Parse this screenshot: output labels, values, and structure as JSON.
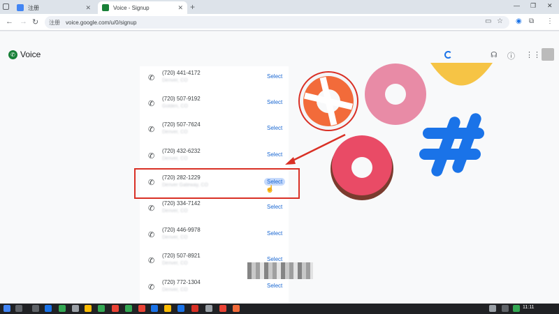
{
  "browser": {
    "tabs": [
      {
        "label": "注册",
        "favicon_color": "#4285f4"
      },
      {
        "label": "Voice - Signup",
        "favicon_color": "#188038"
      }
    ],
    "url": "voice.google.com/u/0/signup",
    "url_chip": "注册"
  },
  "app": {
    "name": "Voice",
    "accent": "#1a73e8"
  },
  "numbers": [
    {
      "number": "(720) 441-4172",
      "location": "Denver, CO",
      "action": "Select"
    },
    {
      "number": "(720) 507-9192",
      "location": "Golden, CO",
      "action": "Select"
    },
    {
      "number": "(720) 507-7624",
      "location": "Denver, CO",
      "action": "Select"
    },
    {
      "number": "(720) 432-6232",
      "location": "Denver, CO",
      "action": "Select"
    },
    {
      "number": "(720) 282-1229",
      "location": "Denver Gateway, CO",
      "action": "Select",
      "highlighted": true
    },
    {
      "number": "(720) 334-7142",
      "location": "Denver, CO",
      "action": "Select"
    },
    {
      "number": "(720) 446-9978",
      "location": "Denver, CO",
      "action": "Select"
    },
    {
      "number": "(720) 507-8921",
      "location": "Denver, CO",
      "action": "Select"
    },
    {
      "number": "(720) 772-1304",
      "location": "Denver, CO",
      "action": "Select"
    }
  ],
  "annotation": {
    "color": "#d93025"
  },
  "taskbar": {
    "time": "11:11"
  }
}
